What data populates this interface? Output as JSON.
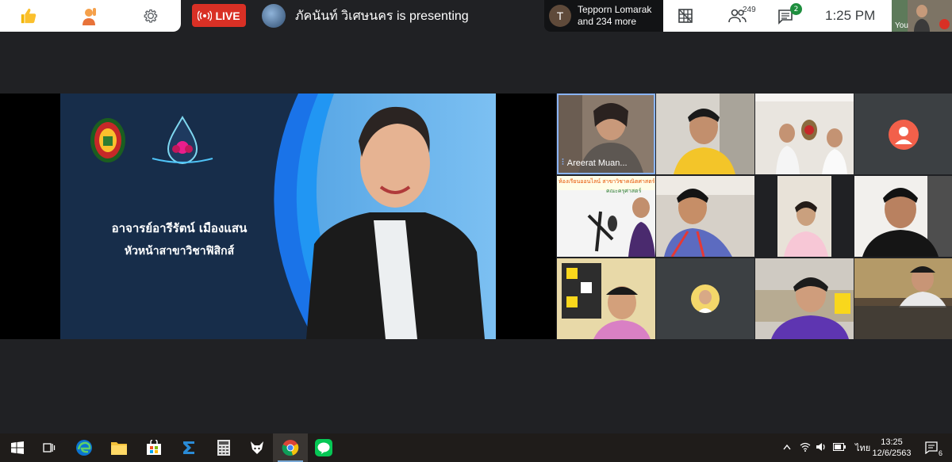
{
  "meet": {
    "live_label": "LIVE",
    "presenting_text": "ภัคนันท์ วิเศษนคร is presenting",
    "participants_chip": {
      "initial": "T",
      "line1": "Tepporn Lomarak",
      "line2": "and 234 more"
    },
    "people_count": "249",
    "chat_count": "2",
    "clock": "1:25 PM",
    "self_label": "You"
  },
  "slide": {
    "title_line1": "อาจารย์อารีรัตน์  เมืองแสน",
    "title_line2": "หัวหน้าสาขาวิชาฟิสิกส์"
  },
  "tiles": {
    "speaker_name": "Areerat Muan...",
    "banner_line1": "ห้องเรียนออนไลน์  สาขาวิชาคณิตศาสตร์",
    "banner_line2": "คณะครุศาสตร์"
  },
  "taskbar": {
    "ime": "ไทย",
    "time": "13:25",
    "date": "12/6/2563",
    "notif_count": "6"
  },
  "colors": {
    "live_red": "#d93025",
    "badge_green": "#1e8e3e",
    "meet_bg": "#202124",
    "slide_blue": "#1a73e8"
  }
}
